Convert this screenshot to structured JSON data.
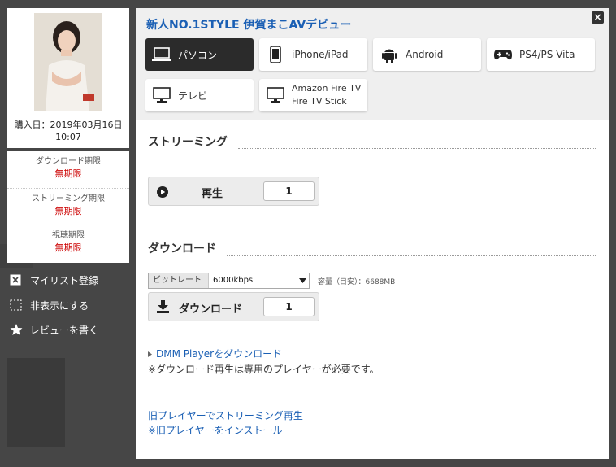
{
  "modal": {
    "title": "新人NO.1STYLE 伊賀まこAVデビュー",
    "close_label": "×"
  },
  "devices": [
    {
      "label": "パソコン",
      "icon": "laptop-icon",
      "active": true
    },
    {
      "label": "iPhone/iPad",
      "icon": "smartphone-icon",
      "active": false
    },
    {
      "label": "Android",
      "icon": "android-icon",
      "active": false
    },
    {
      "label": "PS4/PS Vita",
      "icon": "gamepad-icon",
      "active": false
    },
    {
      "label": "テレビ",
      "icon": "tv-icon",
      "active": false
    },
    {
      "label_line1": "Amazon Fire TV",
      "label_line2": "Fire TV Stick",
      "icon": "monitor-icon",
      "active": false
    }
  ],
  "streaming": {
    "title": "ストリーミング",
    "play_label": "再生",
    "count": "1"
  },
  "download": {
    "title": "ダウンロード",
    "bitrate_label": "ビットレート",
    "bitrate_value": "6000kbps",
    "capacity": "容量（目安）：6688MB",
    "button_label": "ダウンロード",
    "count": "1"
  },
  "player": {
    "link": "DMM Playerをダウンロード",
    "note": "※ダウンロード再生は専用のプレイヤーが必要です。",
    "old_stream_link": "旧プレイヤーでストリーミング再生",
    "old_install_link": "※旧プレイヤーをインストール"
  },
  "left_panel": {
    "purchase_date_line1": "購入日：2019年03月16日",
    "purchase_date_line2": "10:07",
    "limits": [
      {
        "label": "ダウンロード期限",
        "value": "無期限"
      },
      {
        "label": "ストリーミング期限",
        "value": "無期限"
      },
      {
        "label": "視聴期限",
        "value": "無期限"
      }
    ],
    "actions": [
      {
        "label": "マイリスト登録",
        "icon": "mylist-add-icon"
      },
      {
        "label": "非表示にする",
        "icon": "hide-icon"
      },
      {
        "label": "レビューを書く",
        "icon": "star-icon"
      }
    ]
  },
  "colors": {
    "accent_blue": "#1a5fb4",
    "limit_red": "#cc0000",
    "active_device_bg": "#2b2b2b"
  }
}
